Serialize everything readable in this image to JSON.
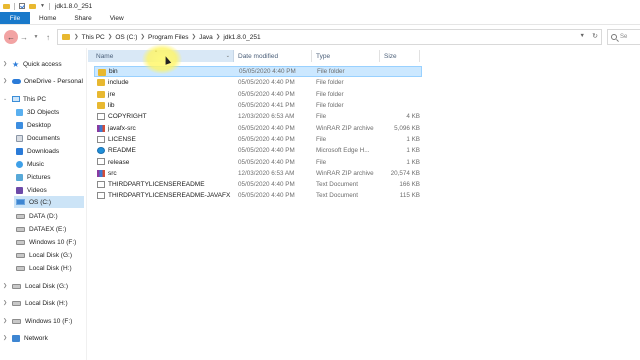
{
  "window": {
    "title": "jdk1.8.0_251"
  },
  "ribbon": {
    "tabs": [
      "File",
      "Home",
      "Share",
      "View"
    ]
  },
  "address": {
    "crumbs": [
      "This PC",
      "OS (C:)",
      "Program Files",
      "Java",
      "jdk1.8.0_251"
    ]
  },
  "search": {
    "placeholder": "Se"
  },
  "nav": {
    "items": [
      {
        "label": "Quick access",
        "icon": "star-icon"
      },
      {
        "label": "OneDrive - Personal",
        "icon": "cloud-icon"
      },
      {
        "label": "This PC",
        "icon": "pc-icon"
      },
      {
        "label": "3D Objects",
        "icon": "3d-objects-icon"
      },
      {
        "label": "Desktop",
        "icon": "desktop-icon"
      },
      {
        "label": "Documents",
        "icon": "documents-icon"
      },
      {
        "label": "Downloads",
        "icon": "downloads-icon"
      },
      {
        "label": "Music",
        "icon": "music-icon"
      },
      {
        "label": "Pictures",
        "icon": "pictures-icon"
      },
      {
        "label": "Videos",
        "icon": "videos-icon"
      },
      {
        "label": "OS (C:)",
        "icon": "os-drive-icon"
      },
      {
        "label": "DATA (D:)",
        "icon": "drive-icon"
      },
      {
        "label": "DATAEX (E:)",
        "icon": "drive-icon"
      },
      {
        "label": "Windows 10 (F:)",
        "icon": "drive-icon"
      },
      {
        "label": "Local Disk (G:)",
        "icon": "drive-icon"
      },
      {
        "label": "Local Disk (H:)",
        "icon": "drive-icon"
      },
      {
        "label": "Local Disk (G:)",
        "icon": "drive-icon"
      },
      {
        "label": "Local Disk (H:)",
        "icon": "drive-icon"
      },
      {
        "label": "Windows 10 (F:)",
        "icon": "drive-icon"
      },
      {
        "label": "Network",
        "icon": "network-icon"
      }
    ]
  },
  "columns": {
    "name": "Name",
    "date": "Date modified",
    "type": "Type",
    "size": "Size"
  },
  "files": [
    {
      "name": "bin",
      "date": "05/05/2020 4:40 PM",
      "type": "File folder",
      "size": "",
      "icon": "folder-icon"
    },
    {
      "name": "include",
      "date": "05/05/2020 4:40 PM",
      "type": "File folder",
      "size": "",
      "icon": "folder-icon"
    },
    {
      "name": "jre",
      "date": "05/05/2020 4:40 PM",
      "type": "File folder",
      "size": "",
      "icon": "folder-icon"
    },
    {
      "name": "lib",
      "date": "05/05/2020 4:41 PM",
      "type": "File folder",
      "size": "",
      "icon": "folder-icon"
    },
    {
      "name": "COPYRIGHT",
      "date": "12/03/2020 6:53 AM",
      "type": "File",
      "size": "4 KB",
      "icon": "file-icon"
    },
    {
      "name": "javafx-src",
      "date": "05/05/2020 4:40 PM",
      "type": "WinRAR ZIP archive",
      "size": "5,096 KB",
      "icon": "winrar-icon"
    },
    {
      "name": "LICENSE",
      "date": "05/05/2020 4:40 PM",
      "type": "File",
      "size": "1 KB",
      "icon": "file-icon"
    },
    {
      "name": "README",
      "date": "05/05/2020 4:40 PM",
      "type": "Microsoft Edge H...",
      "size": "1 KB",
      "icon": "edge-icon"
    },
    {
      "name": "release",
      "date": "05/05/2020 4:40 PM",
      "type": "File",
      "size": "1 KB",
      "icon": "file-icon"
    },
    {
      "name": "src",
      "date": "12/03/2020 6:53 AM",
      "type": "WinRAR ZIP archive",
      "size": "20,574 KB",
      "icon": "winrar-icon"
    },
    {
      "name": "THIRDPARTYLICENSEREADME",
      "date": "05/05/2020 4:40 PM",
      "type": "Text Document",
      "size": "166 KB",
      "icon": "text-file-icon"
    },
    {
      "name": "THIRDPARTYLICENSEREADME-JAVAFX",
      "date": "05/05/2020 4:40 PM",
      "type": "Text Document",
      "size": "115 KB",
      "icon": "text-file-icon"
    }
  ],
  "selected_index": 0,
  "colors": {
    "file_tab": "#1979ca",
    "selection": "#cce8ff",
    "folder": "#e8b830"
  }
}
